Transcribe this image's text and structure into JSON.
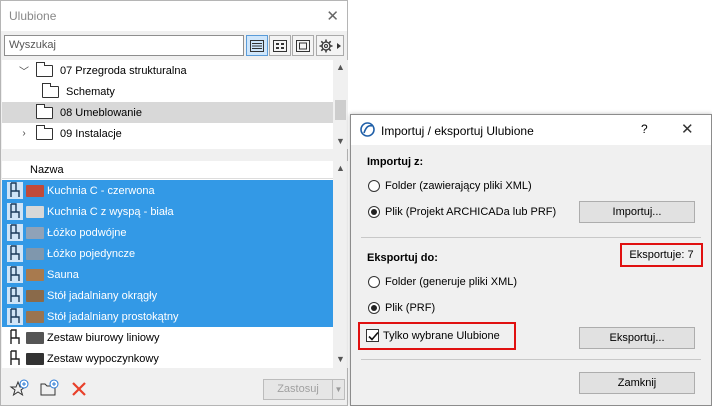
{
  "palette": {
    "title": "Ulubione",
    "search_placeholder": "Wyszukaj",
    "tree": [
      {
        "label": "07 Przegroda strukturalna",
        "expanded": true
      },
      {
        "label": "Schematy"
      },
      {
        "label": "08 Umeblowanie",
        "selected": true
      },
      {
        "label": "09 Instalacje",
        "expanded": false
      }
    ],
    "list_header": "Nazwa",
    "items": [
      {
        "label": "Kuchnia C - czerwona",
        "selected": true,
        "thumb": "#c04a3a"
      },
      {
        "label": "Kuchnia C z wyspą - biała",
        "selected": true,
        "thumb": "#d8d8d8"
      },
      {
        "label": "Łóżko podwójne",
        "selected": true,
        "thumb": "#8fa2b8"
      },
      {
        "label": "Łóżko pojedyncze",
        "selected": true,
        "thumb": "#7f97ad"
      },
      {
        "label": "Sauna",
        "selected": true,
        "thumb": "#a87a4e"
      },
      {
        "label": "Stół jadalniany okrągły",
        "selected": true,
        "thumb": "#8a6a4a"
      },
      {
        "label": "Stół jadalniany prostokątny",
        "selected": true,
        "thumb": "#9a7450"
      },
      {
        "label": "Zestaw biurowy liniowy",
        "selected": false,
        "thumb": "#555555"
      },
      {
        "label": "Zestaw wypoczynkowy",
        "selected": false,
        "thumb": "#333333"
      }
    ],
    "apply_label": "Zastosuj"
  },
  "dialog": {
    "title": "Importuj / eksportuj Ulubione",
    "help": "?",
    "import_heading": "Importuj z:",
    "import_option_folder": "Folder (zawierający pliki XML)",
    "import_option_file": "Plik (Projekt ARCHICADa lub PRF)",
    "import_button": "Importuj...",
    "export_heading": "Eksportuj do:",
    "export_count": "Eksportuje: 7",
    "export_option_folder": "Folder (generuje pliki XML)",
    "export_option_file": "Plik (PRF)",
    "only_selected_label": "Tylko wybrane Ulubione",
    "only_selected_checked": true,
    "export_button": "Eksportuj...",
    "close_button": "Zamknij"
  },
  "colors": {
    "selection_blue": "#3399e6",
    "highlight_red": "#e01010",
    "delete_red": "#e8402a"
  }
}
